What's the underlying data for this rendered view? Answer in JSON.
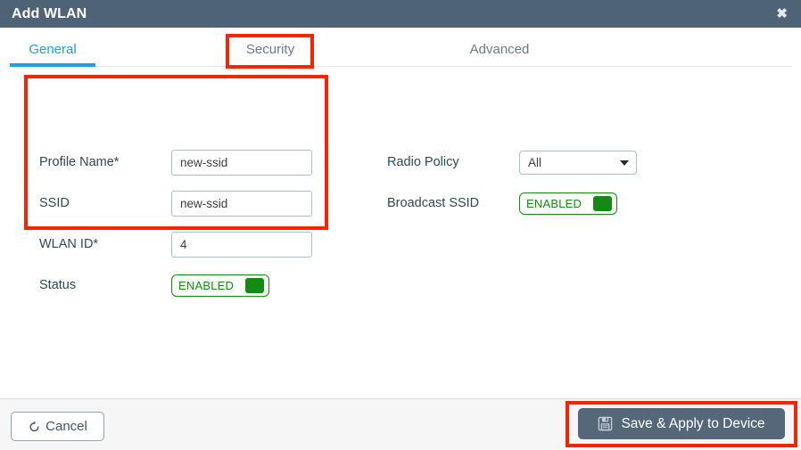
{
  "window": {
    "title": "Add WLAN",
    "close_icon": "close-icon",
    "header_color": "#4f6376"
  },
  "tabs": [
    {
      "label": "General",
      "active": true
    },
    {
      "label": "Security",
      "active": false
    },
    {
      "label": "Advanced",
      "active": false
    }
  ],
  "form": {
    "left": [
      {
        "label": "Profile Name*",
        "type": "text",
        "value": "new-ssid"
      },
      {
        "label": "SSID",
        "type": "text",
        "value": "new-ssid"
      },
      {
        "label": "WLAN ID*",
        "type": "text",
        "value": "4"
      },
      {
        "label": "Status",
        "type": "toggle",
        "value": "ENABLED"
      }
    ],
    "right": [
      {
        "label": "Radio Policy",
        "type": "select",
        "value": "All"
      },
      {
        "label": "Broadcast SSID",
        "type": "toggle",
        "value": "ENABLED"
      }
    ]
  },
  "footer": {
    "cancel_label": "Cancel",
    "cancel_icon": "undo-arrow-icon",
    "save_label": "Save & Apply to Device",
    "save_icon": "floppy-disk-save-icon",
    "save_button_color": "#54687a"
  },
  "annotations": {
    "color": "#f72400",
    "boxes": [
      "security-tab",
      "general-fields-group",
      "save-apply-button"
    ]
  }
}
